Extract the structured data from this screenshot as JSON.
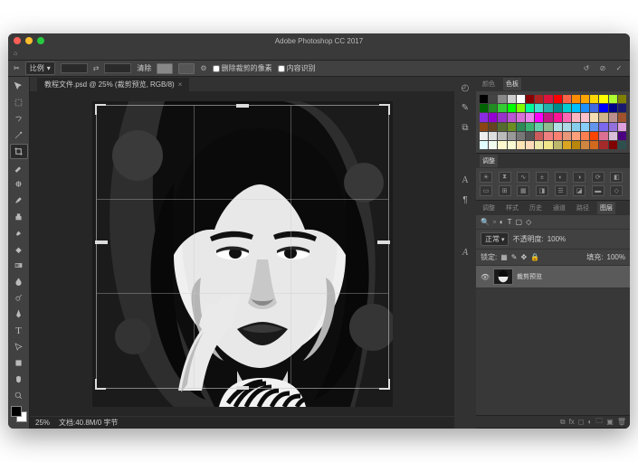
{
  "app": {
    "title": "Adobe Photoshop CC 2017"
  },
  "document": {
    "tab_label": "教程文件.psd @ 25% (裁剪预览, RGB/8)",
    "zoom": "25%",
    "status": "文档:40.8M/0 字节"
  },
  "optbar": {
    "ratio_label": "比例",
    "ratio_value": "",
    "clear_label": "清除",
    "grid_btn1": "田",
    "grid_btn2": "▦",
    "checkbox_delete": "删除裁剪的像素",
    "checkbox_contentaware": "内容识别"
  },
  "swatch_panel": {
    "tab1": "颜色",
    "tab2": "色板"
  },
  "adjust_panel": {
    "tab1": "调整"
  },
  "layers_panel": {
    "tabs": [
      "调整",
      "样式",
      "历史",
      "通道",
      "路径",
      "图层"
    ],
    "blend_label": "正常",
    "opacity_label": "不透明度:",
    "opacity_value": "100%",
    "lock_label": "锁定:",
    "fill_label": "填充:",
    "fill_value": "100%",
    "layer_name": "裁剪预览"
  },
  "swatches": [
    "#000",
    "#444",
    "#888",
    "#ccc",
    "#fff",
    "#8b0000",
    "#b22222",
    "#dc143c",
    "#ff0000",
    "#ff6347",
    "#ff8c00",
    "#ffa500",
    "#ffd700",
    "#ffff00",
    "#adff2f",
    "#808000",
    "#006400",
    "#228b22",
    "#32cd32",
    "#00ff00",
    "#7fff00",
    "#00fa9a",
    "#40e0d0",
    "#20b2aa",
    "#008b8b",
    "#00ced1",
    "#00bfff",
    "#1e90ff",
    "#4169e1",
    "#0000ff",
    "#00008b",
    "#191970",
    "#8a2be2",
    "#9400d3",
    "#9932cc",
    "#ba55d3",
    "#da70d6",
    "#ee82ee",
    "#ff00ff",
    "#c71585",
    "#ff1493",
    "#ff69b4",
    "#ffb6c1",
    "#ffc0cb",
    "#f5deb3",
    "#d2b48c",
    "#bc8f8f",
    "#a0522d",
    "#8b4513",
    "#654321",
    "#556b2f",
    "#6b8e23",
    "#2e8b57",
    "#3cb371",
    "#66cdaa",
    "#8fbc8f",
    "#b0e0e6",
    "#add8e6",
    "#87ceeb",
    "#87cefa",
    "#6495ed",
    "#7b68ee",
    "#9370db",
    "#dda0dd",
    "#eee",
    "#ddd",
    "#bbb",
    "#999",
    "#777",
    "#555",
    "#cd5c5c",
    "#f08080",
    "#fa8072",
    "#e9967a",
    "#ffa07a",
    "#ff7f50",
    "#ff4500",
    "#db7093",
    "#d8bfd8",
    "#4b0082",
    "#e0ffff",
    "#f0fff0",
    "#fffacd",
    "#fafad2",
    "#ffe4b5",
    "#ffdab9",
    "#eee8aa",
    "#f0e68c",
    "#bdb76b",
    "#daa520",
    "#b8860b",
    "#cd853f",
    "#d2691e",
    "#a52a2a",
    "#800000",
    "#2f4f4f"
  ]
}
